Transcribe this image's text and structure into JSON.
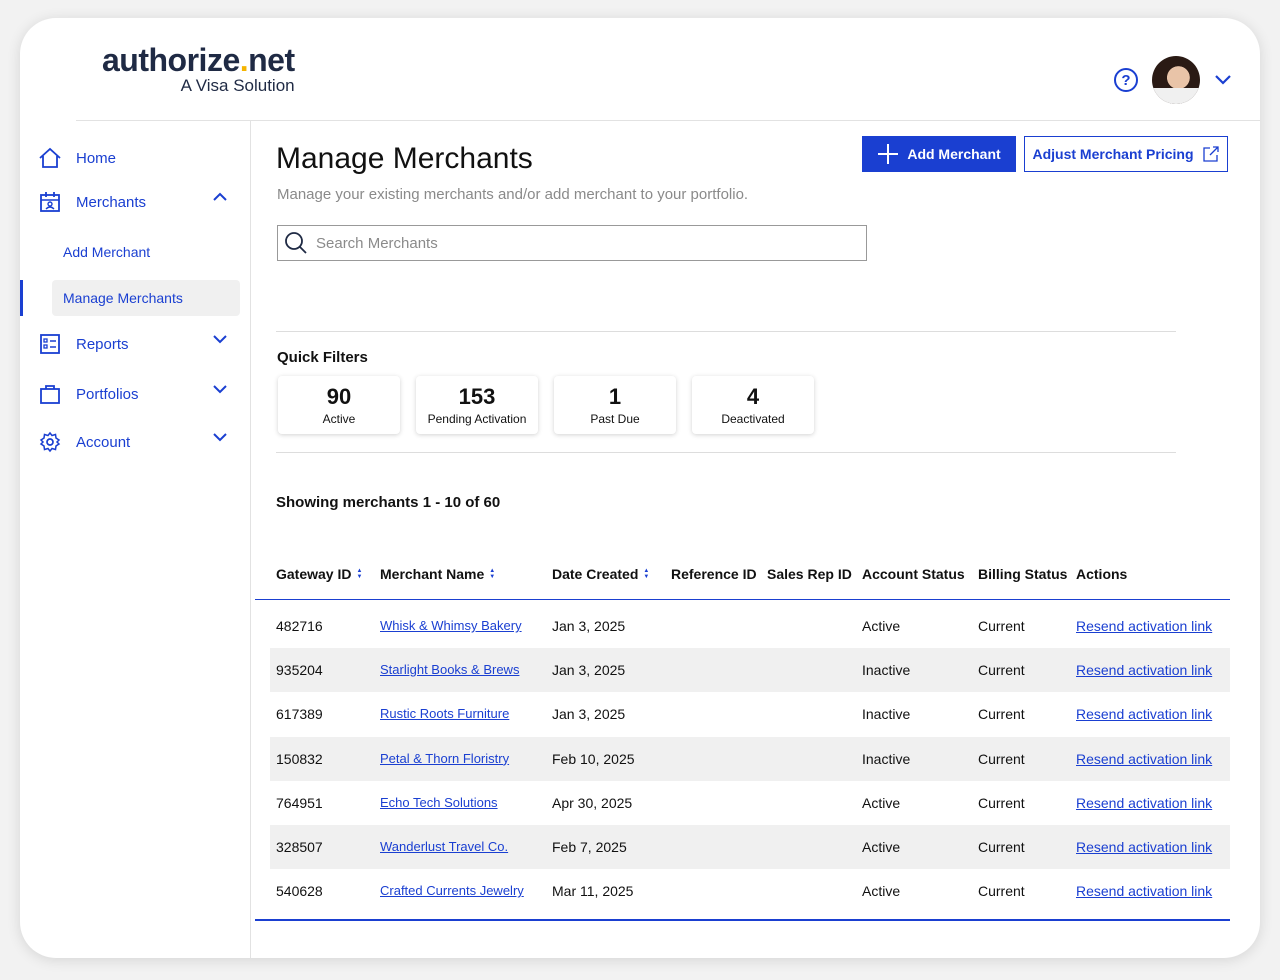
{
  "brand": {
    "wordmark_pre": "authorize",
    "wordmark_dot": ".",
    "wordmark_post": "net",
    "tagline": "A Visa Solution"
  },
  "header": {
    "help_icon": "help-circle-icon",
    "avatar": "user-avatar",
    "menu_caret": "chevron-down-icon"
  },
  "sidebar": {
    "home": "Home",
    "merchants": "Merchants",
    "add_merchant": "Add Merchant",
    "manage_merchants": "Manage Merchants",
    "reports": "Reports",
    "portfolios": "Portfolios",
    "account": "Account"
  },
  "main": {
    "title": "Manage Merchants",
    "subtitle": "Manage your existing merchants and/or add merchant to your portfolio.",
    "add_button": "Add Merchant",
    "pricing_button": "Adjust Merchant Pricing",
    "search_placeholder": "Search Merchants",
    "quick_filters_title": "Quick Filters",
    "quick_filters": [
      {
        "count": "90",
        "label": "Active"
      },
      {
        "count": "153",
        "label": "Pending Activation"
      },
      {
        "count": "1",
        "label": "Past Due"
      },
      {
        "count": "4",
        "label": "Deactivated"
      }
    ],
    "showing": "Showing merchants 1 - 10 of 60"
  },
  "table": {
    "columns": [
      "Gateway ID",
      "Merchant Name",
      "Date Created",
      "Reference ID",
      "Sales Rep ID",
      "Account Status",
      "Billing Status",
      "Actions"
    ],
    "rows": [
      {
        "id": "482716",
        "name": "Whisk & Whimsy Bakery",
        "date": "Jan 3, 2025",
        "ref": "",
        "rep": "",
        "status": "Active",
        "billing": "Current",
        "action": "Resend activation link"
      },
      {
        "id": "935204",
        "name": "Starlight Books & Brews",
        "date": "Jan 3, 2025",
        "ref": "",
        "rep": "",
        "status": "Inactive",
        "billing": "Current",
        "action": "Resend activation link"
      },
      {
        "id": "617389",
        "name": "Rustic Roots Furniture",
        "date": "Jan 3, 2025",
        "ref": "",
        "rep": "",
        "status": "Inactive",
        "billing": "Current",
        "action": "Resend activation link"
      },
      {
        "id": "150832",
        "name": "Petal & Thorn Floristry",
        "date": "Feb 10, 2025",
        "ref": "",
        "rep": "",
        "status": "Inactive",
        "billing": "Current",
        "action": "Resend activation link"
      },
      {
        "id": "764951",
        "name": "Echo Tech Solutions",
        "date": "Apr 30, 2025",
        "ref": "",
        "rep": "",
        "status": "Active",
        "billing": "Current",
        "action": "Resend activation link"
      },
      {
        "id": "328507",
        "name": "Wanderlust Travel Co.",
        "date": "Feb 7, 2025",
        "ref": "",
        "rep": "",
        "status": "Active",
        "billing": "Current",
        "action": "Resend activation link"
      },
      {
        "id": "540628",
        "name": "Crafted Currents Jewelry",
        "date": "Mar 11, 2025",
        "ref": "",
        "rep": "",
        "status": "Active",
        "billing": "Current",
        "action": "Resend activation link"
      }
    ]
  },
  "colors": {
    "accent": "#1a3fd1",
    "brand_dark": "#1f2a44",
    "brand_dot": "#f5b400",
    "row_alt": "#f0f0f0"
  }
}
